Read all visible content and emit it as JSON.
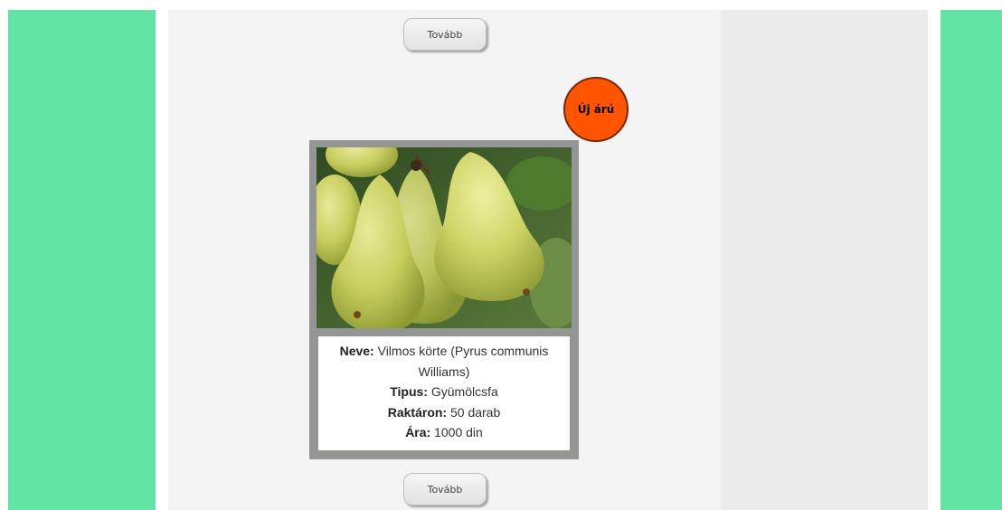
{
  "pager": {
    "next_label_top": "Tovább",
    "next_label_bottom": "Tovább"
  },
  "badge": {
    "label": "Új árú"
  },
  "product": {
    "name_label": "Neve:",
    "name_value_line1": "Vilmos körte (Pyrus communis",
    "name_value_line2": "Williams)",
    "type_label": "Tipus:",
    "type_value": "Gyümölcsfa",
    "stock_label": "Raktáron:",
    "stock_value": "50 darab",
    "price_label": "Ára:",
    "price_value": "1000 din",
    "image_subject": "pears-photo"
  },
  "colors": {
    "stripe": "#62e5a4",
    "main_bg": "#f4f4f4",
    "side_bg": "#ececec",
    "badge": "#ff5500",
    "card_frame": "#949694"
  }
}
